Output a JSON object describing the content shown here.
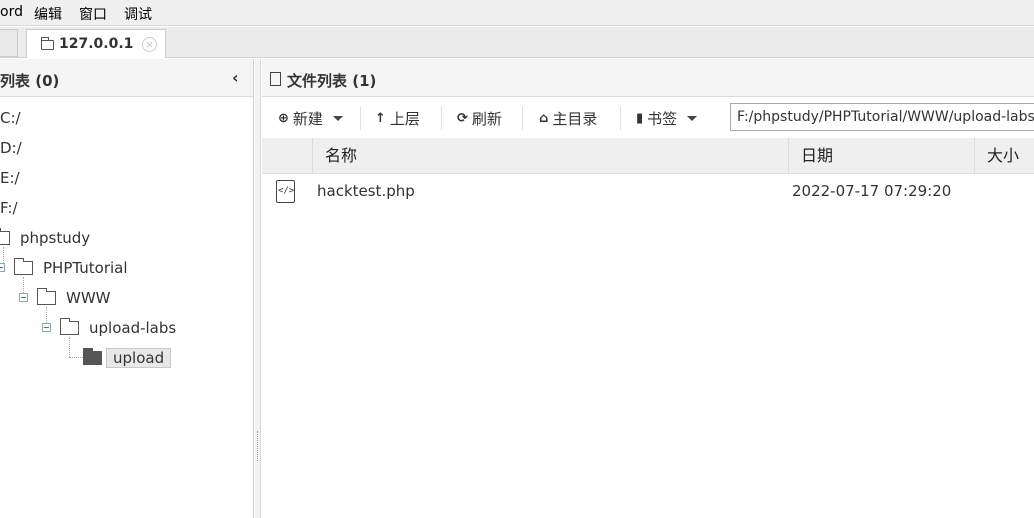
{
  "menu": {
    "items": [
      "ord",
      "编辑",
      "窗口",
      "调试"
    ]
  },
  "tabs": [
    {
      "label": "127.0.0.1",
      "close": "×"
    }
  ],
  "left_panel": {
    "title": "列表 (0)",
    "collapse_glyph": "‹",
    "drives": [
      "C:/",
      "D:/",
      "E:/",
      "F:/"
    ],
    "folders": [
      "phpstudy",
      "PHPTutorial",
      "WWW",
      "upload-labs",
      "upload"
    ],
    "selected_folder": "upload"
  },
  "right_panel": {
    "title": "文件列表 (1)",
    "toolbar": {
      "new_label": "新建",
      "up_label": "上层",
      "refresh_label": "刷新",
      "home_label": "主目录",
      "bookmark_label": "书签",
      "path_value": "F:/phpstudy/PHPTutorial/WWW/upload-labs/u"
    },
    "columns": [
      "名称",
      "日期",
      "大小"
    ],
    "rows": [
      {
        "name": "hacktest.php",
        "date": "2022-07-17 07:29:20",
        "size": ""
      }
    ]
  }
}
